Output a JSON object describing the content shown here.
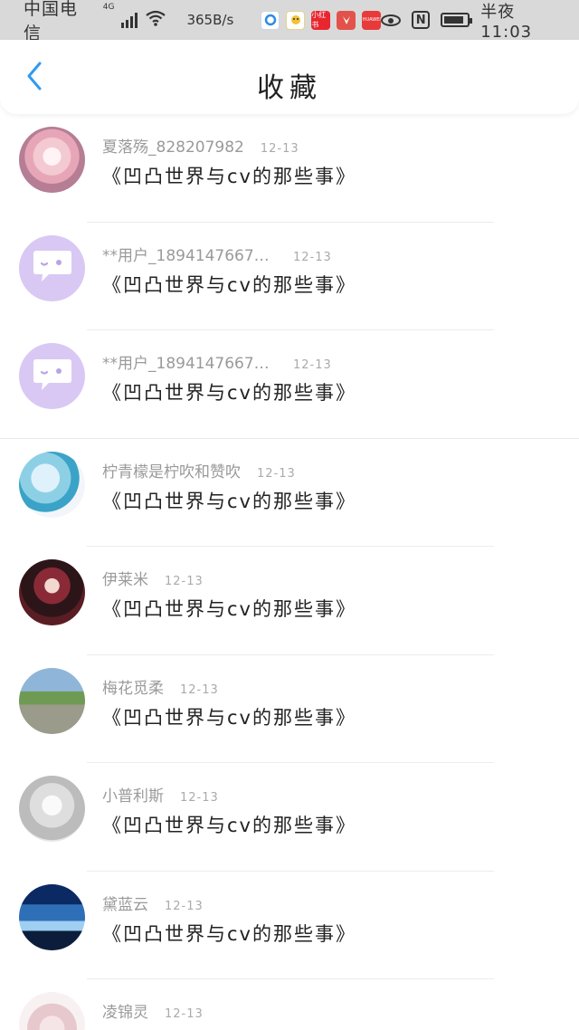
{
  "status_bar": {
    "carrier": "中国电信",
    "network": "4G",
    "speed": "365B/s",
    "time": "半夜11:03",
    "battery_level": 0.85,
    "apps": [
      "qq-browser-icon",
      "baidu-icon",
      "xiaohongshu-icon",
      "huawei-icon",
      "huawei-app-icon"
    ],
    "app_labels": [
      "",
      "",
      "小红书",
      "",
      "HUAWEI"
    ]
  },
  "header": {
    "title": "收藏",
    "back_icon": "chevron-left-icon",
    "accent_color": "#2f9bf2"
  },
  "items": [
    {
      "name": "夏落殇_828207982",
      "date": "12-13",
      "title": "《凹凸世界与cv的那些事》",
      "avatar": "anime-girl-pink"
    },
    {
      "name": "**用户_18941476677…",
      "date": "12-13",
      "title": "《凹凸世界与cv的那些事》",
      "avatar": "default-chat-bubble"
    },
    {
      "name": "**用户_18941476677…",
      "date": "12-13",
      "title": "《凹凸世界与cv的那些事》",
      "avatar": "default-chat-bubble"
    },
    {
      "name": "柠青檬是柠吹和赞吹",
      "date": "12-13",
      "title": "《凹凸世界与cv的那些事》",
      "avatar": "anime-miku"
    },
    {
      "name": "伊莱米",
      "date": "12-13",
      "title": "《凹凸世界与cv的那些事》",
      "avatar": "anime-dark-red"
    },
    {
      "name": "梅花觅柔",
      "date": "12-13",
      "title": "《凹凸世界与cv的那些事》",
      "avatar": "photo-road"
    },
    {
      "name": "小普利斯",
      "date": "12-13",
      "title": "《凹凸世界与cv的那些事》",
      "avatar": "sketch-girl"
    },
    {
      "name": "黛蓝云",
      "date": "12-13",
      "title": "《凹凸世界与cv的那些事》",
      "avatar": "blue-night-sky"
    },
    {
      "name": "凌锦灵",
      "date": "12-13",
      "title": "",
      "avatar": "anime-white-hair"
    }
  ]
}
